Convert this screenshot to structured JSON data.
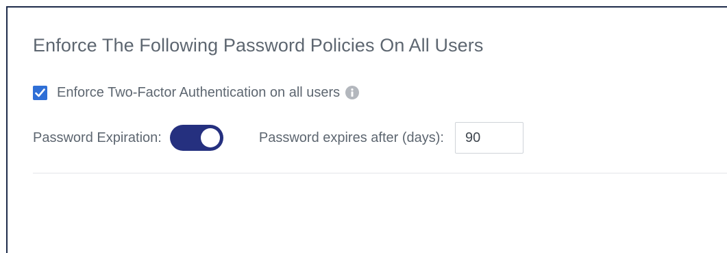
{
  "panel": {
    "title": "Enforce The Following Password Policies On All Users"
  },
  "two_factor": {
    "checked": true,
    "label": "Enforce Two-Factor Authentication on all users",
    "info_icon": "info-icon"
  },
  "password_expiration": {
    "label": "Password Expiration:",
    "enabled": true,
    "days_label": "Password expires after (days):",
    "days_value": "90"
  },
  "colors": {
    "checkbox": "#2f6fd6",
    "toggle_on": "#25307f",
    "text": "#5d6670",
    "frame_border": "#1d2b4a"
  }
}
